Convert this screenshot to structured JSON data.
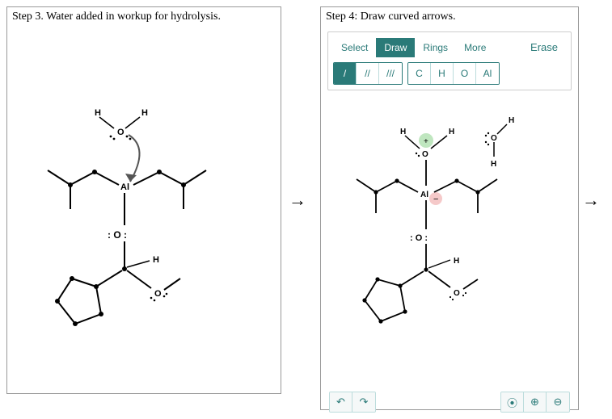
{
  "left": {
    "title": "Step 3. Water added in workup for hydrolysis.",
    "labels": {
      "H1": "H",
      "H2": "H",
      "O1": "O",
      "Al": "Al",
      "Olp": ": O :",
      "H3": "H",
      "O2": "O"
    }
  },
  "arrow": "→",
  "right": {
    "title": "Step 4: Draw curved arrows.",
    "toolbar": {
      "tabs": {
        "select": "Select",
        "draw": "Draw",
        "rings": "Rings",
        "more": "More"
      },
      "erase": "Erase",
      "bonds": {
        "single": "/",
        "double": "//",
        "triple": "///"
      },
      "atoms": {
        "c": "C",
        "h": "H",
        "o": "O",
        "al": "Al"
      }
    },
    "labels": {
      "H1": "H",
      "H2": "H",
      "O1": "O",
      "plus": "+",
      "H3": "H",
      "O3": "O",
      "H4": "H",
      "Al": "Al",
      "minus": "−",
      "Olp": ": O :",
      "H5": "H",
      "O2": "O"
    },
    "bottom": {
      "undo": "↶",
      "redo": "↷",
      "zoomfit": "⦿",
      "zoomin": "⊕",
      "zoomout": "⊖"
    }
  },
  "arrow2": "→"
}
